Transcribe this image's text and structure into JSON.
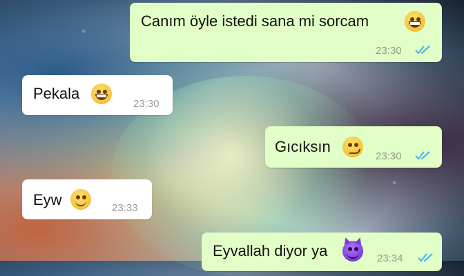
{
  "messages": [
    {
      "direction": "outgoing",
      "text": "Canım öyle istedi sana mi sorcam",
      "emoji": "grinning-face-icon",
      "time": "23:30",
      "status": "read"
    },
    {
      "direction": "incoming",
      "text": "Pekala",
      "emoji": "grinning-face-icon",
      "time": "23:30"
    },
    {
      "direction": "outgoing",
      "text": "Gıcıksın",
      "emoji": "smirking-face-icon",
      "time": "23:30",
      "status": "read"
    },
    {
      "direction": "incoming",
      "text": "Eyw",
      "emoji": "slightly-smiling-face-icon",
      "time": "23:33"
    },
    {
      "direction": "outgoing",
      "text": "Eyvallah diyor ya",
      "emoji": "smiling-devil-face-icon",
      "time": "23:34",
      "status": "read"
    }
  ],
  "colors": {
    "outgoing_bubble": "#e1fec6",
    "incoming_bubble": "#ffffff",
    "read_ticks": "#4fb6ec"
  }
}
